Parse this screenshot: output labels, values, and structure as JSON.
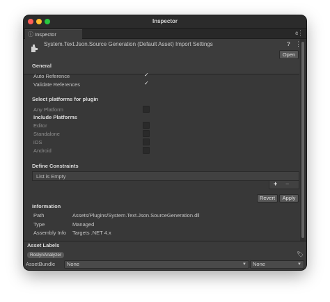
{
  "window": {
    "title": "Inspector"
  },
  "tab": {
    "label": "Inspector",
    "icon": "info-icon"
  },
  "asset": {
    "title": "System.Text.Json.Source Generation (Default Asset) Import Settings",
    "open_label": "Open"
  },
  "general": {
    "heading": "General",
    "auto_reference": {
      "label": "Auto Reference",
      "checked": true
    },
    "validate_references": {
      "label": "Validate References",
      "checked": true
    }
  },
  "platforms": {
    "heading": "Select platforms for plugin",
    "any_platform": {
      "label": "Any Platform",
      "checked": false
    },
    "include_heading": "Include Platforms",
    "items": [
      {
        "label": "Editor",
        "checked": false
      },
      {
        "label": "Standalone",
        "checked": false
      },
      {
        "label": "iOS",
        "checked": false
      },
      {
        "label": "Android",
        "checked": false
      }
    ]
  },
  "constraints": {
    "heading": "Define Constraints",
    "empty_text": "List is Empty",
    "add_label": "+",
    "remove_label": "−"
  },
  "actions": {
    "revert_label": "Revert",
    "apply_label": "Apply"
  },
  "information": {
    "heading": "Information",
    "rows": [
      {
        "key": "Path",
        "value": "Assets/Plugins/System.Text.Json.SourceGeneration.dll"
      },
      {
        "key": "Type",
        "value": "Managed"
      },
      {
        "key": "Assembly Info",
        "value": "Targets .NET 4.x"
      }
    ]
  },
  "asset_labels": {
    "heading": "Asset Labels",
    "chips": [
      "RoslynAnalyzer"
    ],
    "bundle_label": "AssetBundle",
    "bundle_value": "None",
    "variant_value": "None"
  },
  "colors": {
    "window_bg": "#383838",
    "titlebar_bg": "#2b2b2b",
    "close": "#ff5f57",
    "minimize": "#febc2e",
    "maximize": "#28c840"
  }
}
